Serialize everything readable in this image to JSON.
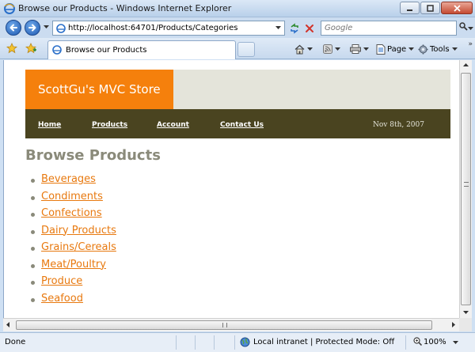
{
  "window": {
    "title": "Browse our Products - Windows Internet Explorer"
  },
  "toolbar": {
    "address": "http://localhost:64701/Products/Categories",
    "search_placeholder": "Google"
  },
  "tab": {
    "label": "Browse our Products"
  },
  "commands": {
    "page_label": "Page",
    "tools_label": "Tools"
  },
  "site": {
    "logo_text": "ScottGu's MVC Store",
    "nav": {
      "items": [
        {
          "label": "Home"
        },
        {
          "label": "Products"
        },
        {
          "label": "Account"
        },
        {
          "label": "Contact Us"
        }
      ],
      "date": "Nov 8th, 2007"
    },
    "heading": "Browse Products",
    "categories": [
      "Beverages",
      "Condiments",
      "Confections",
      "Dairy Products",
      "Grains/Cereals",
      "Meat/Poultry",
      "Produce",
      "Seafood"
    ],
    "colors": {
      "logo_bg": "#f5800c",
      "nav_bg": "#4a4420",
      "link": "#e8790f",
      "heading": "#8a8a7a"
    }
  },
  "status": {
    "text": "Done",
    "zone": "Local intranet | Protected Mode: Off",
    "zoom": "100%"
  },
  "icons": {
    "app": "ie-icon",
    "back": "back-arrow-icon",
    "forward": "forward-arrow-icon",
    "refresh": "refresh-icon",
    "stop": "stop-icon",
    "search": "search-icon",
    "favorites": "favorites-star-icon",
    "add_favorite": "add-favorite-icon",
    "home": "home-icon",
    "feeds": "rss-feed-icon",
    "print": "print-icon",
    "page": "page-icon",
    "tools": "gear-icon",
    "zone": "intranet-globe-icon",
    "zoom": "zoom-icon"
  }
}
